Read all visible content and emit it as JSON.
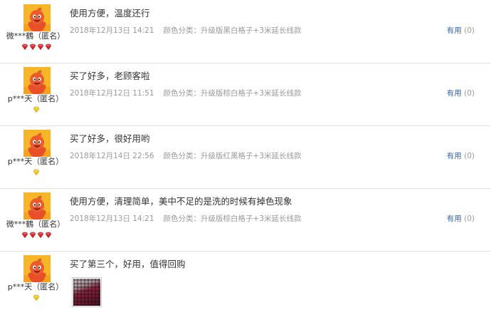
{
  "reviews": [
    {
      "username": "微***鶴（匿名）",
      "comment": "使用方便，温度还行",
      "date": "2018年12月13日 14:21",
      "color_prefix": "颜色分类：",
      "color_value": "升级版黑白格子+3米延长线款",
      "helpful_label": "有用",
      "helpful_count": "(0)",
      "badge_count": 4,
      "badge_type": "red-heart"
    },
    {
      "username": "p***天（匿名）",
      "comment": "买了好多，老顾客啦",
      "date": "2018年12月12日 11:51",
      "color_prefix": "颜色分类：",
      "color_value": "升级版棕白格子+3米延长线款",
      "helpful_label": "有用",
      "helpful_count": "(0)",
      "badge_count": 1,
      "badge_type": "yellow-diamond"
    },
    {
      "username": "p***天（匿名）",
      "comment": "买了好多，很好用哟",
      "date": "2018年12月14日 22:56",
      "color_prefix": "颜色分类：",
      "color_value": "升级版红黑格子+3米延长线款",
      "helpful_label": "有用",
      "helpful_count": "(0)",
      "badge_count": 1,
      "badge_type": "yellow-diamond"
    },
    {
      "username": "微***鶴（匿名）",
      "comment": "使用方便，清理简单，美中不足的是洗的时候有掉色现象",
      "date": "2018年12月13日 14:21",
      "color_prefix": "颜色分类：",
      "color_value": "升级版棕白格子+3米延长线款",
      "helpful_label": "有用",
      "helpful_count": "(0)",
      "badge_count": 4,
      "badge_type": "red-heart"
    },
    {
      "username": "p***天（匿名）",
      "comment": "买了第三个，好用，值得回购",
      "has_photo": true,
      "badge_count": 1,
      "badge_type": "yellow-diamond"
    }
  ],
  "colors": {
    "text": "#333333",
    "meta": "#9a9a9a",
    "link": "#3366aa",
    "divider": "#e2e2e2",
    "avatar_bg": "#f5a623",
    "avatar_figure": "#e8502a"
  },
  "icons": {
    "avatar": "orange-mascot-avatar-icon",
    "red_badge": "red-heart-badge-icon",
    "yellow_badge": "yellow-diamond-badge-icon"
  }
}
